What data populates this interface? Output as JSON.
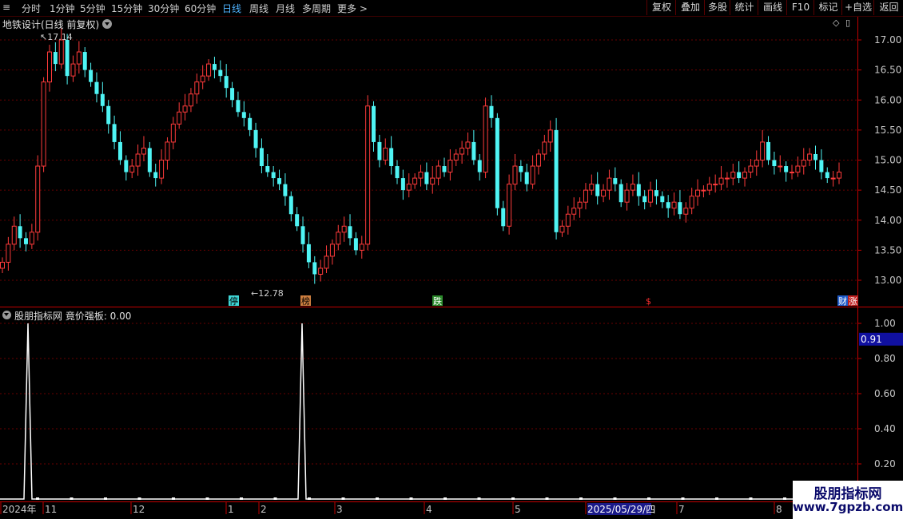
{
  "toolbar": {
    "menu_icon": "≡",
    "periods": [
      "分时",
      "1分钟",
      "5分钟",
      "15分钟",
      "30分钟",
      "60分钟",
      "日线",
      "周线",
      "月线",
      "多周期",
      "更多 >"
    ],
    "active_period": "日线",
    "right_buttons": [
      "复权",
      "叠加",
      "多股",
      "统计",
      "画线",
      "F10",
      "标记",
      "+自选",
      "返回"
    ]
  },
  "main_panel": {
    "title": "地铁设计(日线 前复权)",
    "y_ticks": [
      "17.00",
      "16.50",
      "16.00",
      "15.50",
      "15.00",
      "14.50",
      "14.00",
      "13.50",
      "13.00"
    ],
    "high_label": "17.14",
    "low_label": "12.78",
    "markers": [
      "停",
      "榜",
      "跌",
      "$",
      "财",
      "涨"
    ]
  },
  "indicator_panel": {
    "title": "股朋指标网 竟价强板: 0.00",
    "y_ticks": [
      "1.00",
      "0.80",
      "0.60",
      "0.40",
      "0.20"
    ],
    "current_value": "0.91"
  },
  "x_axis": {
    "labels": [
      "2024年",
      "11",
      "12",
      "1",
      "2",
      "3",
      "4",
      "5",
      "2025/05/29/四",
      "7",
      "8"
    ]
  },
  "watermark": {
    "line1": "股朋指标网",
    "line2": "www.7gpzb.com"
  },
  "colors": {
    "up": "#ff3b3b",
    "down": "#4ff4f4",
    "axis": "#c00000",
    "grid": "#6a0000",
    "active": "#4fb3ff",
    "value_box": "#1010a0"
  },
  "chart_data": {
    "type": "candlestick",
    "title": "地铁设计(日线 前复权)",
    "ylim": [
      12.6,
      17.3
    ],
    "high": 17.14,
    "low": 12.78,
    "close_series": [
      13.3,
      13.6,
      13.9,
      13.7,
      13.6,
      13.8,
      14.9,
      16.3,
      16.8,
      16.6,
      17.0,
      16.4,
      16.6,
      16.8,
      16.5,
      16.3,
      16.1,
      15.9,
      15.6,
      15.3,
      15.0,
      14.8,
      14.9,
      15.1,
      15.2,
      14.8,
      14.7,
      15.0,
      15.3,
      15.6,
      15.8,
      15.9,
      16.1,
      16.3,
      16.4,
      16.6,
      16.5,
      16.4,
      16.2,
      16.0,
      15.8,
      15.7,
      15.5,
      15.2,
      14.9,
      14.8,
      14.7,
      14.6,
      14.4,
      14.1,
      13.9,
      13.6,
      13.3,
      13.1,
      13.2,
      13.4,
      13.6,
      13.8,
      13.9,
      13.7,
      13.5,
      13.6,
      15.9,
      15.3,
      15.0,
      15.2,
      14.9,
      14.7,
      14.5,
      14.6,
      14.7,
      14.8,
      14.6,
      14.7,
      14.9,
      14.8,
      15.0,
      15.1,
      15.2,
      15.3,
      15.0,
      14.8,
      15.9,
      15.7,
      14.2,
      13.9,
      14.6,
      14.9,
      14.8,
      14.6,
      14.9,
      15.1,
      15.3,
      15.5,
      13.8,
      13.9,
      14.1,
      14.2,
      14.3,
      14.5,
      14.6,
      14.4,
      14.5,
      14.7,
      14.6,
      14.3,
      14.5,
      14.6,
      14.4,
      14.3,
      14.5,
      14.4,
      14.3,
      14.2,
      14.3,
      14.1,
      14.2,
      14.4,
      14.5,
      14.5,
      14.6,
      14.6,
      14.7,
      14.7,
      14.8,
      14.7,
      14.8,
      14.9,
      15.0,
      15.3,
      15.0,
      14.9,
      14.9,
      14.8,
      14.8,
      14.9,
      15.0,
      15.1,
      15.0,
      14.8,
      14.7,
      14.7,
      14.8
    ]
  }
}
